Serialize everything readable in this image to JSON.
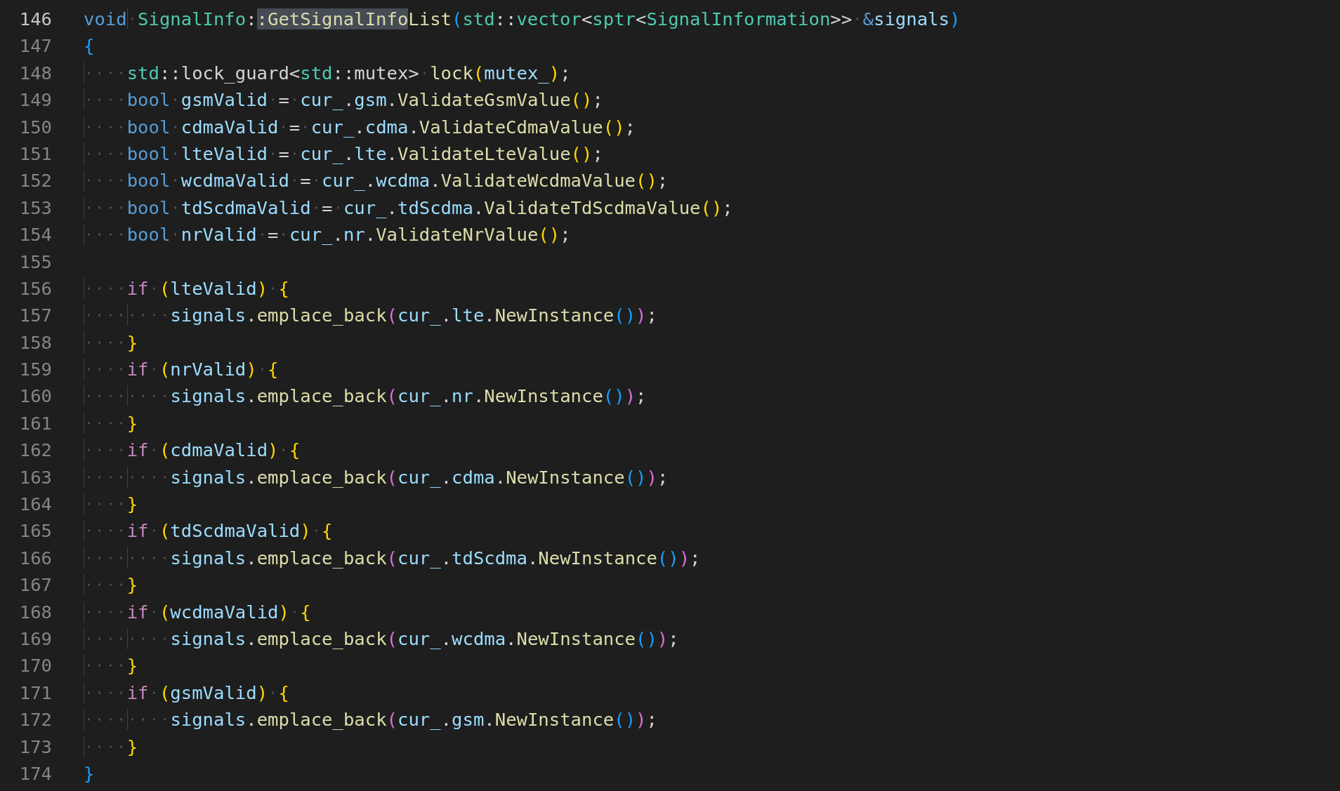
{
  "editor": {
    "lines": [
      {
        "number": "146",
        "current": true,
        "tokens": [
          {
            "text": "void",
            "kind": "kw"
          },
          {
            "text": " SignalInfo",
            "kind": "type"
          },
          {
            "text": ":",
            "kind": "p"
          },
          {
            "text": ":GetSignalInfo",
            "kind": "match"
          },
          {
            "text": "List",
            "kind": "fn"
          },
          {
            "text": "(",
            "kind": "b3"
          },
          {
            "text": "std",
            "kind": "type"
          },
          {
            "text": "::",
            "kind": "p"
          },
          {
            "text": "vector",
            "kind": "type"
          },
          {
            "text": "<",
            "kind": "p"
          },
          {
            "text": "sptr",
            "kind": "type"
          },
          {
            "text": "<",
            "kind": "p"
          },
          {
            "text": "SignalInformation",
            "kind": "type"
          },
          {
            "text": ">>",
            "kind": "p"
          },
          {
            "text": " &",
            "kind": "kw"
          },
          {
            "text": "signals",
            "kind": "var"
          },
          {
            "text": ")",
            "kind": "b3"
          }
        ]
      },
      {
        "number": "147",
        "current": false,
        "tokens": [
          {
            "text": "{",
            "kind": "b3"
          }
        ]
      },
      {
        "number": "148",
        "current": false,
        "tokens": [
          {
            "text": "    std",
            "kind": "type"
          },
          {
            "text": "::lock_guard<",
            "kind": "p"
          },
          {
            "text": "std",
            "kind": "type"
          },
          {
            "text": "::mutex>",
            "kind": "p"
          },
          {
            "text": " lock",
            "kind": "fn"
          },
          {
            "text": "(",
            "kind": "b1"
          },
          {
            "text": "mutex_",
            "kind": "var"
          },
          {
            "text": ")",
            "kind": "b1"
          },
          {
            "text": ";",
            "kind": "p"
          }
        ]
      },
      {
        "number": "149",
        "current": false,
        "tokens": [
          {
            "text": "    bool",
            "kind": "kw"
          },
          {
            "text": " gsmValid",
            "kind": "var"
          },
          {
            "text": " =",
            "kind": "p"
          },
          {
            "text": " cur_",
            "kind": "var"
          },
          {
            "text": ".",
            "kind": "p"
          },
          {
            "text": "gsm",
            "kind": "var"
          },
          {
            "text": ".",
            "kind": "p"
          },
          {
            "text": "ValidateGsmValue",
            "kind": "fn"
          },
          {
            "text": "()",
            "kind": "b1"
          },
          {
            "text": ";",
            "kind": "p"
          }
        ]
      },
      {
        "number": "150",
        "current": false,
        "tokens": [
          {
            "text": "    bool",
            "kind": "kw"
          },
          {
            "text": " cdmaValid",
            "kind": "var"
          },
          {
            "text": " =",
            "kind": "p"
          },
          {
            "text": " cur_",
            "kind": "var"
          },
          {
            "text": ".",
            "kind": "p"
          },
          {
            "text": "cdma",
            "kind": "var"
          },
          {
            "text": ".",
            "kind": "p"
          },
          {
            "text": "ValidateCdmaValue",
            "kind": "fn"
          },
          {
            "text": "()",
            "kind": "b1"
          },
          {
            "text": ";",
            "kind": "p"
          }
        ]
      },
      {
        "number": "151",
        "current": false,
        "tokens": [
          {
            "text": "    bool",
            "kind": "kw"
          },
          {
            "text": " lteValid",
            "kind": "var"
          },
          {
            "text": " =",
            "kind": "p"
          },
          {
            "text": " cur_",
            "kind": "var"
          },
          {
            "text": ".",
            "kind": "p"
          },
          {
            "text": "lte",
            "kind": "var"
          },
          {
            "text": ".",
            "kind": "p"
          },
          {
            "text": "ValidateLteValue",
            "kind": "fn"
          },
          {
            "text": "()",
            "kind": "b1"
          },
          {
            "text": ";",
            "kind": "p"
          }
        ]
      },
      {
        "number": "152",
        "current": false,
        "tokens": [
          {
            "text": "    bool",
            "kind": "kw"
          },
          {
            "text": " wcdmaValid",
            "kind": "var"
          },
          {
            "text": " =",
            "kind": "p"
          },
          {
            "text": " cur_",
            "kind": "var"
          },
          {
            "text": ".",
            "kind": "p"
          },
          {
            "text": "wcdma",
            "kind": "var"
          },
          {
            "text": ".",
            "kind": "p"
          },
          {
            "text": "ValidateWcdmaValue",
            "kind": "fn"
          },
          {
            "text": "()",
            "kind": "b1"
          },
          {
            "text": ";",
            "kind": "p"
          }
        ]
      },
      {
        "number": "153",
        "current": false,
        "tokens": [
          {
            "text": "    bool",
            "kind": "kw"
          },
          {
            "text": " tdScdmaValid",
            "kind": "var"
          },
          {
            "text": " =",
            "kind": "p"
          },
          {
            "text": " cur_",
            "kind": "var"
          },
          {
            "text": ".",
            "kind": "p"
          },
          {
            "text": "tdScdma",
            "kind": "var"
          },
          {
            "text": ".",
            "kind": "p"
          },
          {
            "text": "ValidateTdScdmaValue",
            "kind": "fn"
          },
          {
            "text": "()",
            "kind": "b1"
          },
          {
            "text": ";",
            "kind": "p"
          }
        ]
      },
      {
        "number": "154",
        "current": false,
        "tokens": [
          {
            "text": "    bool",
            "kind": "kw"
          },
          {
            "text": " nrValid",
            "kind": "var"
          },
          {
            "text": " =",
            "kind": "p"
          },
          {
            "text": " cur_",
            "kind": "var"
          },
          {
            "text": ".",
            "kind": "p"
          },
          {
            "text": "nr",
            "kind": "var"
          },
          {
            "text": ".",
            "kind": "p"
          },
          {
            "text": "ValidateNrValue",
            "kind": "fn"
          },
          {
            "text": "()",
            "kind": "b1"
          },
          {
            "text": ";",
            "kind": "p"
          }
        ]
      },
      {
        "number": "155",
        "current": false
      },
      {
        "number": "156",
        "current": false,
        "tokens": [
          {
            "text": "    if",
            "kind": "ctrl"
          },
          {
            "text": " (",
            "kind": "b1"
          },
          {
            "text": "lteValid",
            "kind": "var"
          },
          {
            "text": ")",
            "kind": "b1"
          },
          {
            "text": " {",
            "kind": "b1"
          }
        ]
      },
      {
        "number": "157",
        "current": false,
        "tokens": [
          {
            "text": "        signals",
            "kind": "var"
          },
          {
            "text": ".",
            "kind": "p"
          },
          {
            "text": "emplace_back",
            "kind": "fn"
          },
          {
            "text": "(",
            "kind": "b2"
          },
          {
            "text": "cur_",
            "kind": "var"
          },
          {
            "text": ".",
            "kind": "p"
          },
          {
            "text": "lte",
            "kind": "var"
          },
          {
            "text": ".",
            "kind": "p"
          },
          {
            "text": "NewInstance",
            "kind": "fn"
          },
          {
            "text": "()",
            "kind": "b3"
          },
          {
            "text": ")",
            "kind": "b2"
          },
          {
            "text": ";",
            "kind": "p"
          }
        ]
      },
      {
        "number": "158",
        "current": false,
        "tokens": [
          {
            "text": "    }",
            "kind": "b1"
          }
        ]
      },
      {
        "number": "159",
        "current": false,
        "tokens": [
          {
            "text": "    if",
            "kind": "ctrl"
          },
          {
            "text": " (",
            "kind": "b1"
          },
          {
            "text": "nrValid",
            "kind": "var"
          },
          {
            "text": ")",
            "kind": "b1"
          },
          {
            "text": " {",
            "kind": "b1"
          }
        ]
      },
      {
        "number": "160",
        "current": false,
        "tokens": [
          {
            "text": "        signals",
            "kind": "var"
          },
          {
            "text": ".",
            "kind": "p"
          },
          {
            "text": "emplace_back",
            "kind": "fn"
          },
          {
            "text": "(",
            "kind": "b2"
          },
          {
            "text": "cur_",
            "kind": "var"
          },
          {
            "text": ".",
            "kind": "p"
          },
          {
            "text": "nr",
            "kind": "var"
          },
          {
            "text": ".",
            "kind": "p"
          },
          {
            "text": "NewInstance",
            "kind": "fn"
          },
          {
            "text": "()",
            "kind": "b3"
          },
          {
            "text": ")",
            "kind": "b2"
          },
          {
            "text": ";",
            "kind": "p"
          }
        ]
      },
      {
        "number": "161",
        "current": false,
        "tokens": [
          {
            "text": "    }",
            "kind": "b1"
          }
        ]
      },
      {
        "number": "162",
        "current": false,
        "tokens": [
          {
            "text": "    if",
            "kind": "ctrl"
          },
          {
            "text": " (",
            "kind": "b1"
          },
          {
            "text": "cdmaValid",
            "kind": "var"
          },
          {
            "text": ")",
            "kind": "b1"
          },
          {
            "text": " {",
            "kind": "b1"
          }
        ]
      },
      {
        "number": "163",
        "current": false,
        "tokens": [
          {
            "text": "        signals",
            "kind": "var"
          },
          {
            "text": ".",
            "kind": "p"
          },
          {
            "text": "emplace_back",
            "kind": "fn"
          },
          {
            "text": "(",
            "kind": "b2"
          },
          {
            "text": "cur_",
            "kind": "var"
          },
          {
            "text": ".",
            "kind": "p"
          },
          {
            "text": "cdma",
            "kind": "var"
          },
          {
            "text": ".",
            "kind": "p"
          },
          {
            "text": "NewInstance",
            "kind": "fn"
          },
          {
            "text": "()",
            "kind": "b3"
          },
          {
            "text": ")",
            "kind": "b2"
          },
          {
            "text": ";",
            "kind": "p"
          }
        ]
      },
      {
        "number": "164",
        "current": false,
        "tokens": [
          {
            "text": "    }",
            "kind": "b1"
          }
        ]
      },
      {
        "number": "165",
        "current": false,
        "tokens": [
          {
            "text": "    if",
            "kind": "ctrl"
          },
          {
            "text": " (",
            "kind": "b1"
          },
          {
            "text": "tdScdmaValid",
            "kind": "var"
          },
          {
            "text": ")",
            "kind": "b1"
          },
          {
            "text": " {",
            "kind": "b1"
          }
        ]
      },
      {
        "number": "166",
        "current": false,
        "tokens": [
          {
            "text": "        signals",
            "kind": "var"
          },
          {
            "text": ".",
            "kind": "p"
          },
          {
            "text": "emplace_back",
            "kind": "fn"
          },
          {
            "text": "(",
            "kind": "b2"
          },
          {
            "text": "cur_",
            "kind": "var"
          },
          {
            "text": ".",
            "kind": "p"
          },
          {
            "text": "tdScdma",
            "kind": "var"
          },
          {
            "text": ".",
            "kind": "p"
          },
          {
            "text": "NewInstance",
            "kind": "fn"
          },
          {
            "text": "()",
            "kind": "b3"
          },
          {
            "text": ")",
            "kind": "b2"
          },
          {
            "text": ";",
            "kind": "p"
          }
        ]
      },
      {
        "number": "167",
        "current": false,
        "tokens": [
          {
            "text": "    }",
            "kind": "b1"
          }
        ]
      },
      {
        "number": "168",
        "current": false,
        "tokens": [
          {
            "text": "    if",
            "kind": "ctrl"
          },
          {
            "text": " (",
            "kind": "b1"
          },
          {
            "text": "wcdmaValid",
            "kind": "var"
          },
          {
            "text": ")",
            "kind": "b1"
          },
          {
            "text": " {",
            "kind": "b1"
          }
        ]
      },
      {
        "number": "169",
        "current": false,
        "tokens": [
          {
            "text": "        signals",
            "kind": "var"
          },
          {
            "text": ".",
            "kind": "p"
          },
          {
            "text": "emplace_back",
            "kind": "fn"
          },
          {
            "text": "(",
            "kind": "b2"
          },
          {
            "text": "cur_",
            "kind": "var"
          },
          {
            "text": ".",
            "kind": "p"
          },
          {
            "text": "wcdma",
            "kind": "var"
          },
          {
            "text": ".",
            "kind": "p"
          },
          {
            "text": "NewInstance",
            "kind": "fn"
          },
          {
            "text": "()",
            "kind": "b3"
          },
          {
            "text": ")",
            "kind": "b2"
          },
          {
            "text": ";",
            "kind": "p"
          }
        ]
      },
      {
        "number": "170",
        "current": false,
        "tokens": [
          {
            "text": "    }",
            "kind": "b1"
          }
        ]
      },
      {
        "number": "171",
        "current": false,
        "tokens": [
          {
            "text": "    if",
            "kind": "ctrl"
          },
          {
            "text": " (",
            "kind": "b1"
          },
          {
            "text": "gsmValid",
            "kind": "var"
          },
          {
            "text": ")",
            "kind": "b1"
          },
          {
            "text": " {",
            "kind": "b1"
          }
        ]
      },
      {
        "number": "172",
        "current": false,
        "tokens": [
          {
            "text": "        signals",
            "kind": "var"
          },
          {
            "text": ".",
            "kind": "p"
          },
          {
            "text": "emplace_back",
            "kind": "fn"
          },
          {
            "text": "(",
            "kind": "b2"
          },
          {
            "text": "cur_",
            "kind": "var"
          },
          {
            "text": ".",
            "kind": "p"
          },
          {
            "text": "gsm",
            "kind": "var"
          },
          {
            "text": ".",
            "kind": "p"
          },
          {
            "text": "NewInstance",
            "kind": "fn"
          },
          {
            "text": "()",
            "kind": "b3"
          },
          {
            "text": ")",
            "kind": "b2"
          },
          {
            "text": ";",
            "kind": "p"
          }
        ]
      },
      {
        "number": "173",
        "current": false,
        "tokens": [
          {
            "text": "    }",
            "kind": "b1"
          }
        ]
      },
      {
        "number": "174",
        "current": false,
        "tokens": [
          {
            "text": "}",
            "kind": "b3"
          }
        ]
      }
    ]
  }
}
